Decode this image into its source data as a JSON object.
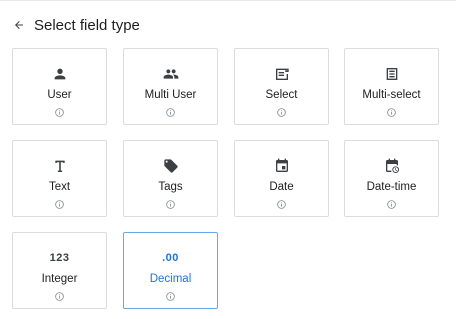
{
  "header": {
    "title": "Select field type"
  },
  "fields": [
    {
      "label": "User",
      "icon": "person-icon"
    },
    {
      "label": "Multi User",
      "icon": "people-icon"
    },
    {
      "label": "Select",
      "icon": "select-icon"
    },
    {
      "label": "Multi-select",
      "icon": "list-box-icon"
    },
    {
      "label": "Text",
      "icon": "text-t-icon"
    },
    {
      "label": "Tags",
      "icon": "tags-icon"
    },
    {
      "label": "Date",
      "icon": "calendar-icon"
    },
    {
      "label": "Date-time",
      "icon": "calendar-clock-icon"
    },
    {
      "label": "Integer",
      "icon": "integer-123-icon",
      "glyph": "123"
    },
    {
      "label": "Decimal",
      "icon": "decimal-icon",
      "glyph": ".00",
      "selected": true
    }
  ],
  "colors": {
    "accent": "#1a73e8",
    "selected_border": "#66a9e6",
    "card_border": "#dadce0"
  }
}
